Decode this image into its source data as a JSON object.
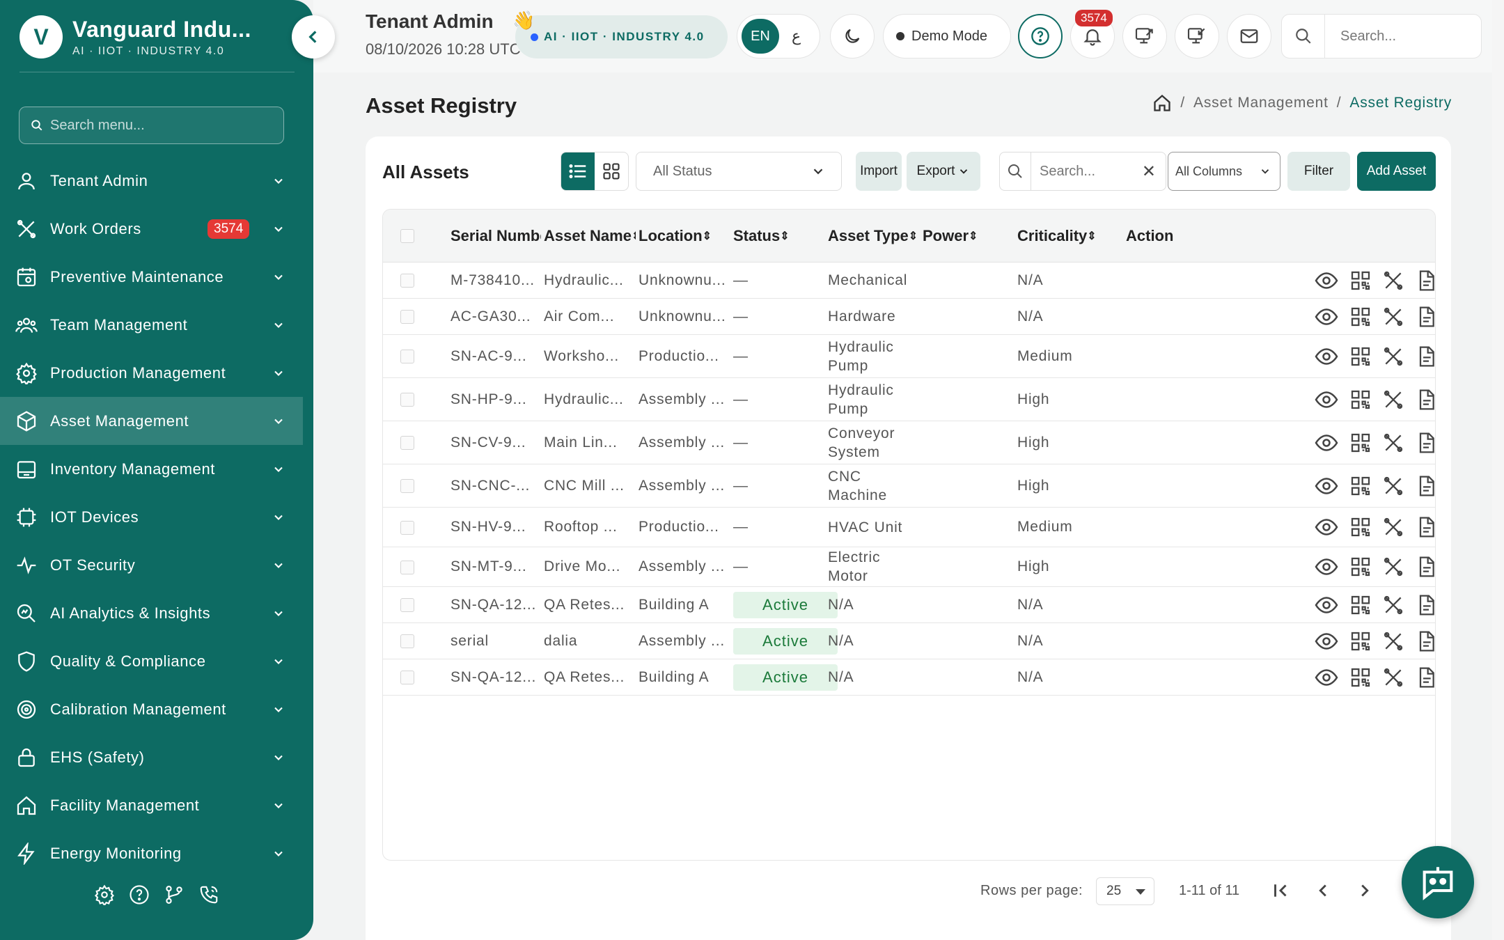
{
  "brand": {
    "name": "Vanguard Indu...",
    "tagline": "AI · IIOT · INDUSTRY 4.0",
    "logo_letter": "V"
  },
  "sidebar": {
    "search_placeholder": "Search menu...",
    "items": [
      {
        "label": "Tenant Admin",
        "icon": "user-icon"
      },
      {
        "label": "Work Orders",
        "icon": "tools-icon",
        "badge": "3574"
      },
      {
        "label": "Preventive Maintenance",
        "icon": "calendar-gear-icon"
      },
      {
        "label": "Team Management",
        "icon": "team-icon"
      },
      {
        "label": "Production Management",
        "icon": "gear-icon"
      },
      {
        "label": "Asset Management",
        "icon": "cube-icon",
        "active": true
      },
      {
        "label": "Inventory Management",
        "icon": "inventory-icon"
      },
      {
        "label": "IOT Devices",
        "icon": "iot-chip-icon"
      },
      {
        "label": "OT Security",
        "icon": "pulse-icon"
      },
      {
        "label": "AI Analytics & Insights",
        "icon": "analytics-icon"
      },
      {
        "label": "Quality & Compliance",
        "icon": "shield-icon"
      },
      {
        "label": "Calibration Management",
        "icon": "target-icon"
      },
      {
        "label": "EHS (Safety)",
        "icon": "lock-icon"
      },
      {
        "label": "Facility Management",
        "icon": "home-icon"
      },
      {
        "label": "Energy Monitoring",
        "icon": "bolt-icon"
      }
    ],
    "footer_icons": [
      "settings-icon",
      "help-icon",
      "branch-icon",
      "phone-icon"
    ]
  },
  "topbar": {
    "title": "Tenant Admin",
    "greeting_emoji": "👋",
    "datetime": "08/10/2026 10:28 UTC",
    "ai_pill": "AI · IIOT · INDUSTRY 4.0",
    "lang_en": "EN",
    "lang_ar": "ع",
    "demo_mode": "Demo Mode",
    "notif_count": "3574",
    "search_placeholder": "Search..."
  },
  "page": {
    "title": "Asset Registry",
    "breadcrumb": [
      "Asset Management",
      "Asset Registry"
    ]
  },
  "toolbar": {
    "card_title": "All Assets",
    "status_select": "All Status",
    "import": "Import",
    "export": "Export",
    "search_placeholder": "Search...",
    "columns_select": "All Columns",
    "filter": "Filter",
    "add": "Add Asset"
  },
  "table": {
    "columns": [
      "Serial Numbe",
      "Asset Name",
      "Location",
      "Status",
      "Asset Type",
      "Power",
      "Criticality",
      "Action"
    ],
    "rows": [
      {
        "serial": "M-738410...",
        "name": "Hydraulic...",
        "location": "Unknownu...",
        "status": "—",
        "type": "Mechanical",
        "power": "",
        "criticality": "N/A"
      },
      {
        "serial": "AC-GA30...",
        "name": "Air Com...",
        "location": "Unknownu...",
        "status": "—",
        "type": "Hardware",
        "power": "",
        "criticality": "N/A"
      },
      {
        "serial": "SN-AC-9...",
        "name": "Worksho...",
        "location": "Productio...",
        "status": "—",
        "type": "Hydraulic Pump",
        "power": "",
        "criticality": "Medium"
      },
      {
        "serial": "SN-HP-9...",
        "name": "Hydraulic...",
        "location": "Assembly ...",
        "status": "—",
        "type": "Hydraulic Pump",
        "power": "",
        "criticality": "High"
      },
      {
        "serial": "SN-CV-9...",
        "name": "Main Lin...",
        "location": "Assembly ...",
        "status": "—",
        "type": "Conveyor System",
        "power": "",
        "criticality": "High"
      },
      {
        "serial": "SN-CNC-...",
        "name": "CNC Mill ...",
        "location": "Assembly ...",
        "status": "—",
        "type": "CNC Machine",
        "power": "",
        "criticality": "High"
      },
      {
        "serial": "SN-HV-9...",
        "name": "Rooftop ...",
        "location": "Productio...",
        "status": "—",
        "type": "HVAC Unit",
        "power": "",
        "criticality": "Medium"
      },
      {
        "serial": "SN-MT-9...",
        "name": "Drive Mo...",
        "location": "Assembly ...",
        "status": "—",
        "type": "Electric Motor",
        "power": "",
        "criticality": "High"
      },
      {
        "serial": "SN-QA-12...",
        "name": "QA Retes...",
        "location": "Building A",
        "status": "Active",
        "type": "N/A",
        "power": "",
        "criticality": "N/A"
      },
      {
        "serial": "serial",
        "name": "dalia",
        "location": "Assembly ...",
        "status": "Active",
        "type": "N/A",
        "power": "",
        "criticality": "N/A"
      },
      {
        "serial": "SN-QA-12...",
        "name": "QA Retes...",
        "location": "Building A",
        "status": "Active",
        "type": "N/A",
        "power": "",
        "criticality": "N/A"
      }
    ]
  },
  "pagination": {
    "rows_label": "Rows per page:",
    "rows_value": "25",
    "range": "1-11 of 11"
  },
  "colors": {
    "primary": "#0d6b63",
    "badge": "#e53935",
    "active_bg": "#e3f4e8",
    "active_text": "#1b7a3a"
  }
}
